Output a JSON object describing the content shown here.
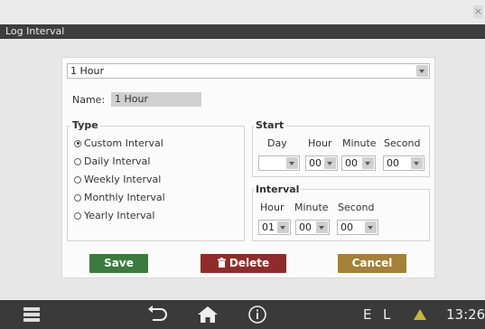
{
  "window": {
    "close_label": "×",
    "title": "Log Interval"
  },
  "preset": {
    "selected": "1 Hour"
  },
  "name": {
    "label": "Name:",
    "value": "1 Hour"
  },
  "type": {
    "legend": "Type",
    "options": [
      {
        "label": "Custom Interval",
        "selected": true
      },
      {
        "label": "Daily Interval",
        "selected": false
      },
      {
        "label": "Weekly Interval",
        "selected": false
      },
      {
        "label": "Monthly Interval",
        "selected": false
      },
      {
        "label": "Yearly Interval",
        "selected": false
      }
    ]
  },
  "start": {
    "legend": "Start",
    "headers": [
      "Day",
      "Hour",
      "Minute",
      "Second"
    ],
    "values": [
      "",
      "00",
      "00",
      "00"
    ]
  },
  "interval": {
    "legend": "Interval",
    "headers": [
      "Hour",
      "Minute",
      "Second"
    ],
    "values": [
      "01",
      "00",
      "00"
    ]
  },
  "buttons": {
    "save": "Save",
    "delete": "Delete",
    "cancel": "Cancel"
  },
  "status": {
    "indicator_e": "E",
    "indicator_l": "L",
    "time": "13:26"
  },
  "colors": {
    "save": "#3c7a3e",
    "delete": "#8f2c2a",
    "cancel": "#a48038",
    "warning": "#c7b63b"
  }
}
